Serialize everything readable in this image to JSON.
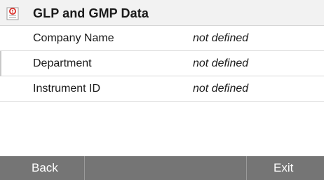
{
  "header": {
    "title": "GLP and GMP Data",
    "icon": "protocol-document-icon",
    "icon_accent_color": "#d9302a"
  },
  "rows": [
    {
      "label": "Company Name",
      "value": "not defined"
    },
    {
      "label": "Department",
      "value": "not defined"
    },
    {
      "label": "Instrument ID",
      "value": "not defined"
    }
  ],
  "footer": {
    "back_label": "Back",
    "middle_label": "",
    "exit_label": "Exit"
  },
  "colors": {
    "header_bg": "#f2f2f2",
    "footer_bg": "#757575",
    "text": "#1a1a1a"
  }
}
